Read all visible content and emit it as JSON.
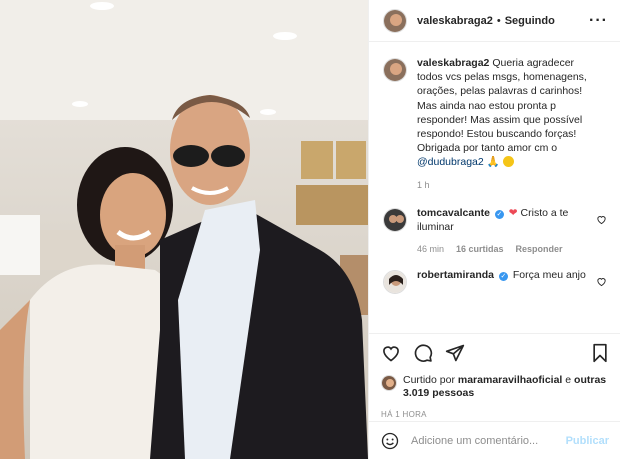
{
  "post": {
    "author": "valeskabraga2",
    "follow_status": "Seguindo",
    "caption_author": "valeskabraga2",
    "caption_text": "Queria agradecer todos vcs pelas msgs, homenagens, orações, pelas palavras d carinhos! Mas ainda nao estou pronta p responder! Mas assim que possível respondo! Estou buscando forças! Obrigada por tanto amor cm o ",
    "caption_mention": "@dudubraga2",
    "caption_time": "1 h"
  },
  "comments": [
    {
      "author": "tomcavalcante",
      "text": "Cristo a te iluminar",
      "time": "46 min",
      "likes": "16 curtidas",
      "reply": "Responder"
    },
    {
      "author": "robertamiranda",
      "text": "Força meu anjo"
    }
  ],
  "likes": {
    "prefix": "Curtido por",
    "user": "maramaravilhaoficial",
    "connector": "e",
    "others": "outras 3.019 pessoas"
  },
  "timestamp": "HÁ 1 HORA",
  "comment_box": {
    "placeholder": "Adicione um comentário...",
    "publish": "Publicar"
  },
  "colors": {
    "verified": "#3897f0",
    "publish_disabled": "#b2dffc",
    "heart": "#ed4956"
  }
}
